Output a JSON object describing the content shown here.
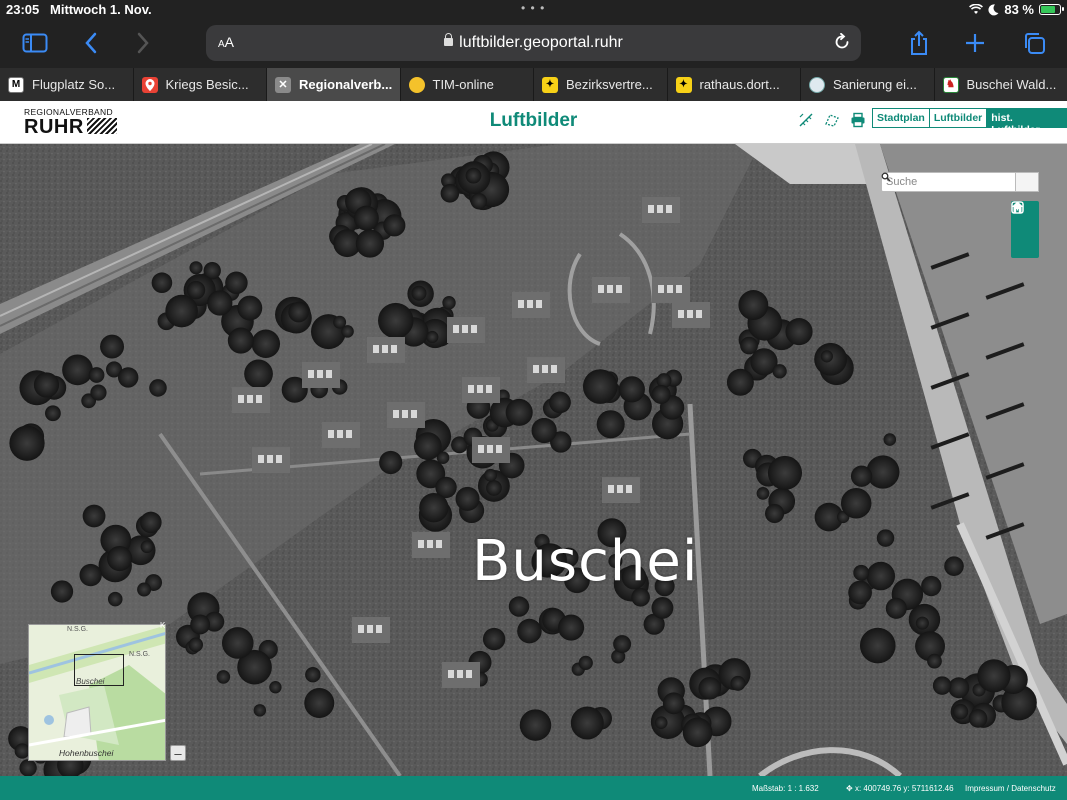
{
  "status_bar": {
    "time": "23:05",
    "date": "Mittwoch 1. Nov.",
    "battery_percent": "83 %",
    "battery_level": 0.83,
    "icons": [
      "wifi-icon",
      "moon-icon",
      "battery-icon"
    ]
  },
  "browser": {
    "text_size_label": "AA",
    "url": "luftbilder.geoportal.ruhr",
    "toolbar_icons": [
      "sidebar-icon",
      "back-icon",
      "forward-icon",
      "reload-icon",
      "share-icon",
      "new-tab-icon",
      "tabs-overview-icon"
    ]
  },
  "tabs": [
    {
      "label": "Flugplatz So...",
      "favicon": "M"
    },
    {
      "label": "Kriegs Besic...",
      "favicon": "map-pin"
    },
    {
      "label": "Regionalverb...",
      "favicon": "close",
      "active": true
    },
    {
      "label": "TIM-online",
      "favicon": "tim"
    },
    {
      "label": "Bezirksvertre...",
      "favicon": "eagle"
    },
    {
      "label": "rathaus.dort...",
      "favicon": "eagle"
    },
    {
      "label": "Sanierung ei...",
      "favicon": "globe"
    },
    {
      "label": "Buschei Wald...",
      "favicon": "nrw"
    }
  ],
  "site": {
    "logo_small": "REGIONALVERBAND",
    "logo_big": "RUHR",
    "title": "Luftbilder",
    "header_icons": [
      "measure-line-icon",
      "measure-area-icon",
      "print-icon"
    ],
    "view_switch": [
      "Stadtplan",
      "Luftbilder",
      "hist. Luftbilder"
    ],
    "active_view": "hist. Luftbilder"
  },
  "map": {
    "place_label": "Buschei",
    "search_placeholder": "Suche",
    "controls": [
      "home-icon",
      "zoom-in-icon",
      "zoom-out-icon"
    ],
    "minimap": {
      "labels": [
        "N.S.G.",
        "N.S.G.",
        "Buschei",
        "Hohenbuschei"
      ],
      "collapse_label": "–",
      "corner_mark": "K"
    }
  },
  "footer": {
    "scale": "Maßstab: 1 : 1.632",
    "coordinates": "x: 400749.76 y: 5711612.46",
    "links": "Impressum / Datenschutz"
  },
  "colors": {
    "brand_teal": "#0f8a78",
    "browser_chrome": "#222222",
    "active_tab": "#4a4a4a",
    "battery_green": "#36c759"
  }
}
